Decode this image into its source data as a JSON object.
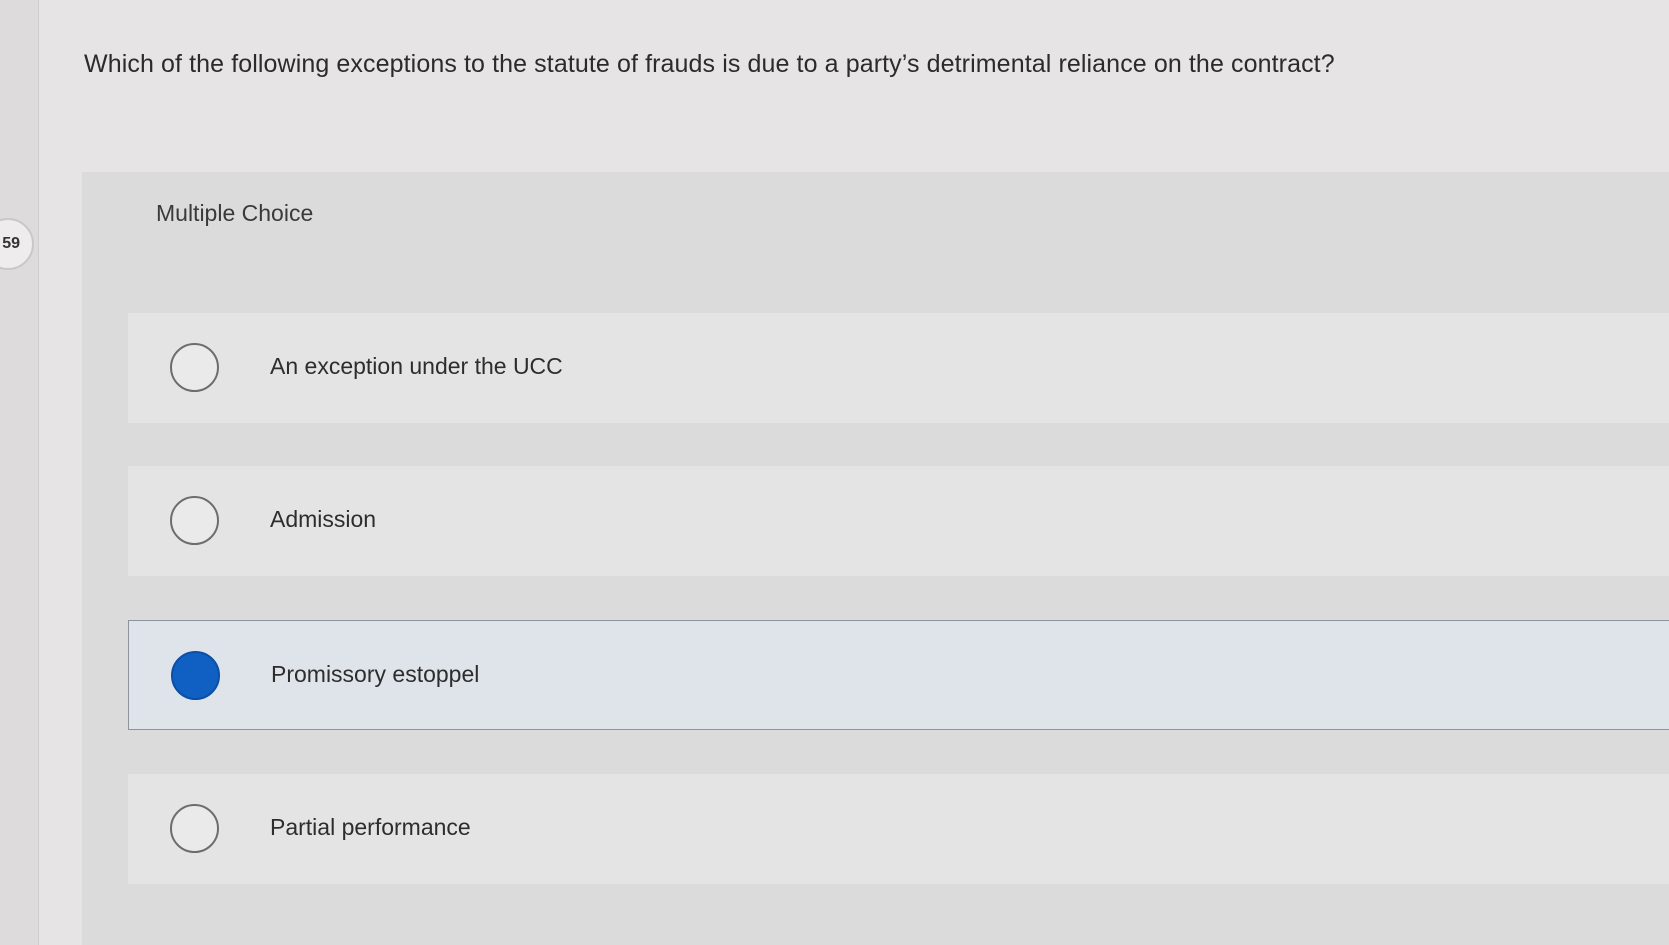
{
  "question": {
    "number": "59",
    "text": "Which of the following exceptions to the statute of frauds is due to a party’s detrimental reliance on the contract?"
  },
  "choices": {
    "heading": "Multiple Choice",
    "options": [
      {
        "label": "An exception under the UCC",
        "selected": false
      },
      {
        "label": "Admission",
        "selected": false
      },
      {
        "label": "Promissory estoppel",
        "selected": true
      },
      {
        "label": "Partial performance",
        "selected": false
      }
    ]
  },
  "colors": {
    "selected_radio": "#1060c4",
    "selected_option_bg": "#dfe4ea"
  }
}
